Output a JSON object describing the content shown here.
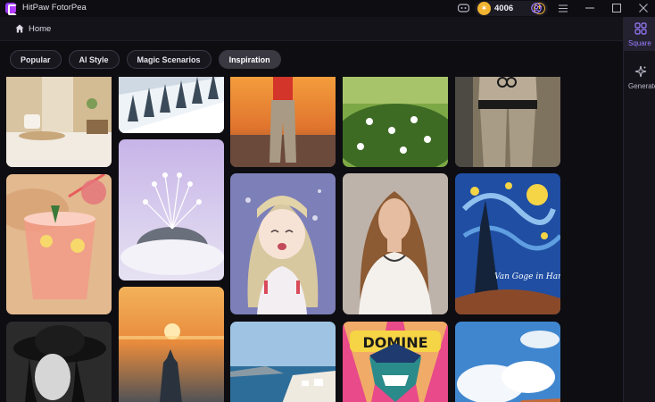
{
  "window": {
    "title": "HitPaw FotorPea",
    "coin_count": "4006",
    "coin_glyph": "✶",
    "accent_color": "#8a5cff",
    "coin_color": "#f2b430",
    "title_icons": [
      "discord-icon",
      "coin-icon",
      "add-coins-icon",
      "user-icon",
      "menu-icon",
      "minimize-icon",
      "maximize-icon",
      "close-icon"
    ]
  },
  "header": {
    "home_label": "Home"
  },
  "tabs": [
    {
      "label": "Popular",
      "active": false
    },
    {
      "label": "AI Style",
      "active": false
    },
    {
      "label": "Magic Scenarios",
      "active": false
    },
    {
      "label": "Inspiration",
      "active": true
    }
  ],
  "sidebar": {
    "items": [
      {
        "label": "Square",
        "icon": "square-grid-icon",
        "active": true
      },
      {
        "label": "Generate",
        "icon": "sparkle-generate-icon",
        "active": false
      }
    ]
  },
  "gallery": {
    "images": [
      {
        "name": "living-room-interior"
      },
      {
        "name": "snowy-forest-slope"
      },
      {
        "name": "figure-at-sunset-beach"
      },
      {
        "name": "white-flowers-meadow"
      },
      {
        "name": "chanel-tracksuit-fashion"
      },
      {
        "name": "tropical-cocktail-drink"
      },
      {
        "name": "frosted-dandelion-stone"
      },
      {
        "name": "anime-elf-girl"
      },
      {
        "name": "woman-white-dress-portrait"
      },
      {
        "name": "starry-night-van-gogh"
      },
      {
        "name": "woman-in-hat-bw"
      },
      {
        "name": "sunset-over-sea-castle"
      },
      {
        "name": "santorini-coastline"
      },
      {
        "name": "domine-joker-popart"
      },
      {
        "name": "blue-sky-clouds-coast"
      }
    ],
    "caption_vangogh": "Van Goge in Harit",
    "caption_popart": "DOMINE"
  }
}
